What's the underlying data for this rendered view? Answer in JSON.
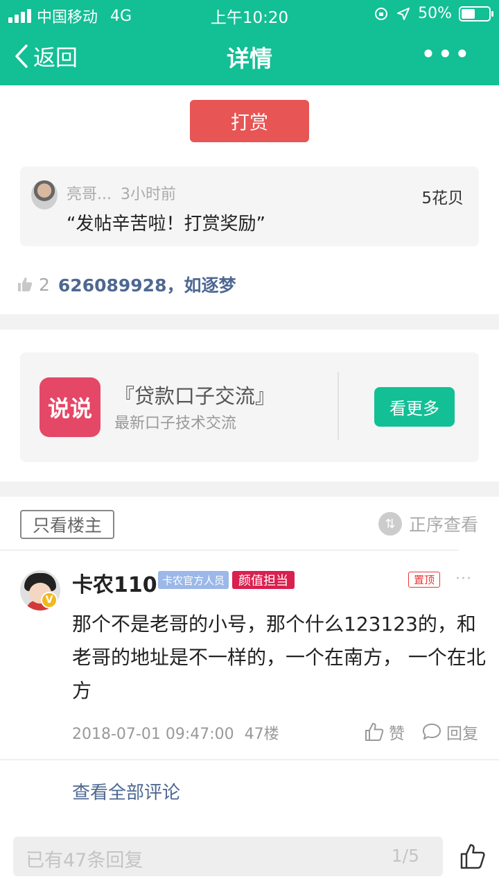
{
  "status_bar": {
    "carrier": "中国移动",
    "network": "4G",
    "time": "上午10:20",
    "battery_text": "50%",
    "battery_level": 0.5
  },
  "nav": {
    "back_label": "返回",
    "title": "详情",
    "more_label": "•••"
  },
  "reward": {
    "button_label": "打赏",
    "user": "亮哥...",
    "time_ago": "3小时前",
    "amount": "5花贝",
    "message": "“发帖辛苦啦！打赏奖励”"
  },
  "likes": {
    "count": "2",
    "names": "626089928，如逐梦"
  },
  "promo": {
    "logo_text": "说说",
    "title": "『贷款口子交流』",
    "subtitle": "最新口子技术交流",
    "button_label": "看更多"
  },
  "filters": {
    "owner_only_label": "只看楼主",
    "sort_label": "正序查看"
  },
  "post": {
    "author": "卡农110",
    "badge_official": "卡农官方人员",
    "badge_beauty": "颜值担当",
    "badge_pinned": "置顶",
    "more_label": "···",
    "verify_mark": "V",
    "content": "那个不是老哥的小号，那个什么123123的，和老哥的地址是不一样的，一个在南方， 一个在北方",
    "datetime": "2018-07-01 09:47:00",
    "floor": "47楼",
    "like_label": "赞",
    "reply_label": "回复",
    "view_all_label": "查看全部评论"
  },
  "bottom_bar": {
    "placeholder": "已有47条回复",
    "page": "1/5"
  }
}
